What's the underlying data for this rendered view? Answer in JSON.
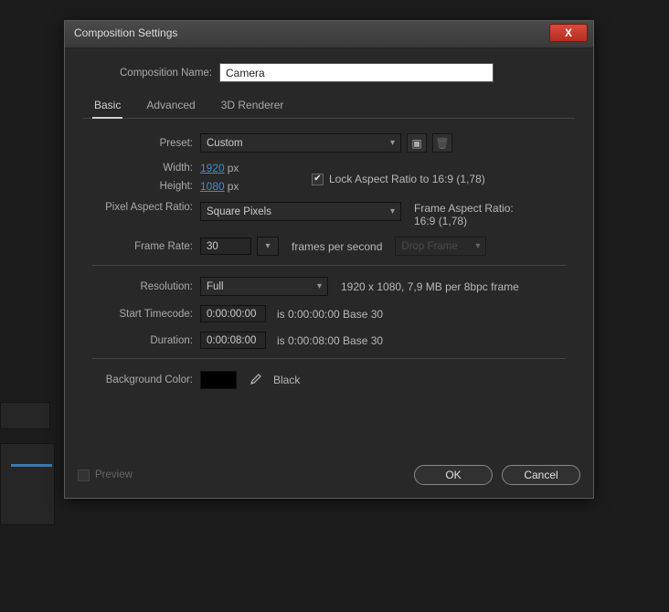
{
  "dialog": {
    "title": "Composition Settings",
    "close_label": "X",
    "comp_name_label": "Composition Name:",
    "comp_name_value": "Camera"
  },
  "tabs": {
    "basic": "Basic",
    "advanced": "Advanced",
    "renderer": "3D Renderer"
  },
  "basic": {
    "preset_label": "Preset:",
    "preset_value": "Custom",
    "width_label": "Width:",
    "width_value": "1920",
    "height_label": "Height:",
    "height_value": "1080",
    "px_unit": "px",
    "lock_aspect_label": "Lock Aspect Ratio to 16:9 (1,78)",
    "par_label": "Pixel Aspect Ratio:",
    "par_value": "Square Pixels",
    "far_label": "Frame Aspect Ratio:",
    "far_value": "16:9 (1,78)",
    "framerate_label": "Frame Rate:",
    "framerate_value": "30",
    "fps_text": "frames per second",
    "dropframe_value": "Drop Frame",
    "resolution_label": "Resolution:",
    "resolution_value": "Full",
    "resolution_info": "1920 x 1080, 7,9 MB per 8bpc frame",
    "start_tc_label": "Start Timecode:",
    "start_tc_value": "0:00:00:00",
    "start_tc_info": "is 0:00:00:00  Base 30",
    "duration_label": "Duration:",
    "duration_value": "0:00:08:00",
    "duration_info": "is 0:00:08:00  Base 30",
    "bgcolor_label": "Background Color:",
    "bgcolor_name": "Black"
  },
  "footer": {
    "preview_label": "Preview",
    "ok": "OK",
    "cancel": "Cancel"
  }
}
